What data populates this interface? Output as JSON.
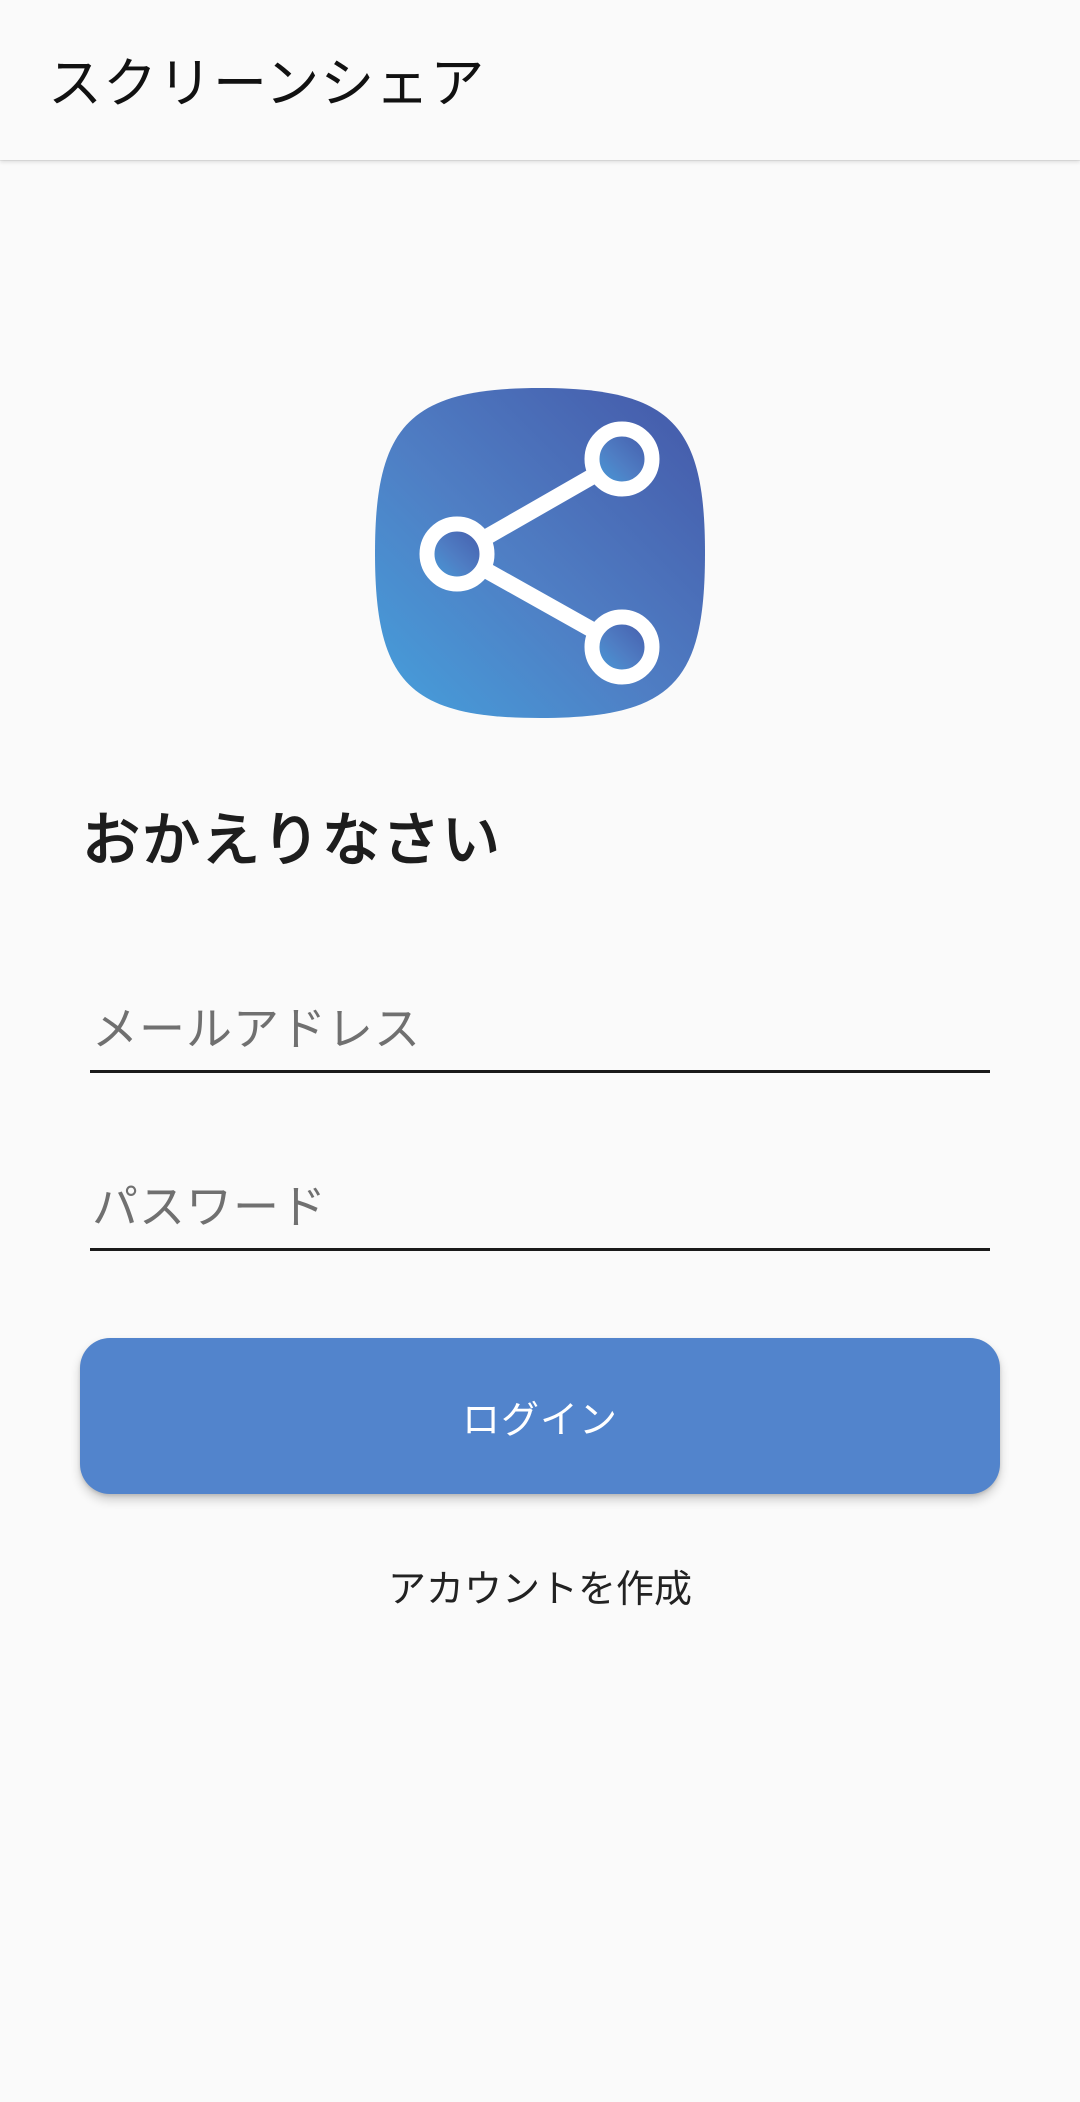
{
  "app_bar": {
    "title": "スクリーンシェア"
  },
  "logo": {
    "icon": "share-icon",
    "gradient_start": "#45a0dc",
    "gradient_end": "#4458a8"
  },
  "login": {
    "heading": "おかえりなさい",
    "email_placeholder": "メールアドレス",
    "password_placeholder": "パスワード",
    "login_label": "ログイン",
    "create_account_label": "アカウントを作成"
  },
  "colors": {
    "primary": "#5284cc",
    "background": "#fafafa"
  }
}
